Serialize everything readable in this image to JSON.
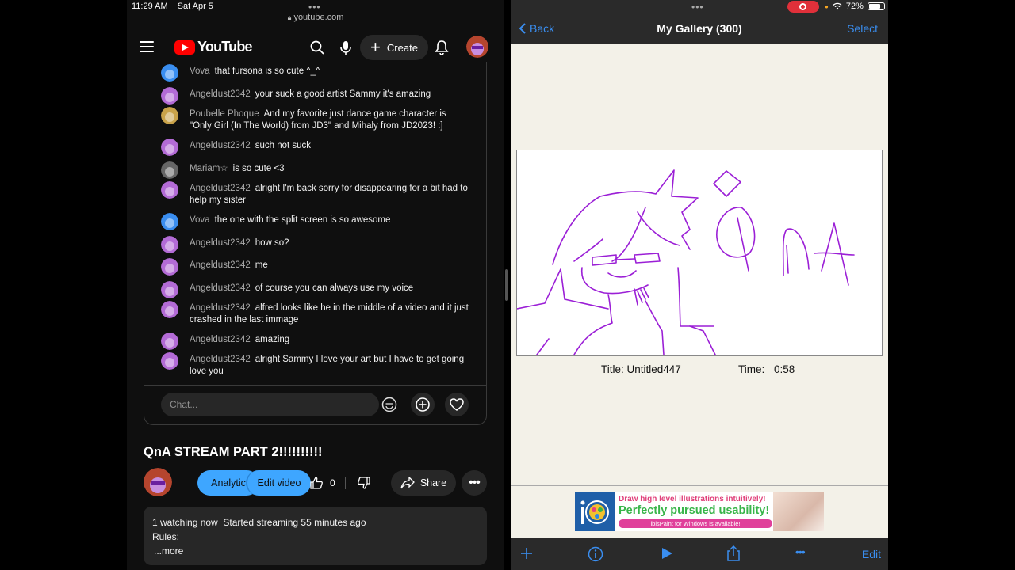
{
  "status": {
    "time": "11:29 AM",
    "date": "Sat Apr 5",
    "battery": "72%"
  },
  "browser": {
    "url": "youtube.com"
  },
  "youtube": {
    "logo_text": "YouTube",
    "create_label": "Create",
    "chat": [
      {
        "name": "Vova",
        "text": "that fursona is so cute ^_^",
        "avatar": "blue"
      },
      {
        "name": "Angeldust2342",
        "text": "your suck a good artist Sammy it's amazing",
        "avatar": "purple"
      },
      {
        "name": "Poubelle Phoque",
        "text": "And my favorite just dance game character is \"Only Girl (In The World) from JD3\" and Mihaly from JD2023! :]",
        "avatar": "gold"
      },
      {
        "name": "Angeldust2342",
        "text": "such not suck",
        "avatar": "purple"
      },
      {
        "name": "Mariam☆",
        "text": "is so cute <3",
        "avatar": "grey"
      },
      {
        "name": "Angeldust2342",
        "text": "alright I'm back sorry for disappearing for a bit had to help my sister",
        "avatar": "purple"
      },
      {
        "name": "Vova",
        "text": "the one with the split screen is so awesome",
        "avatar": "blue"
      },
      {
        "name": "Angeldust2342",
        "text": "how so?",
        "avatar": "purple"
      },
      {
        "name": "Angeldust2342",
        "text": "me",
        "avatar": "purple"
      },
      {
        "name": "Angeldust2342",
        "text": "of course you can always use my voice",
        "avatar": "purple"
      },
      {
        "name": "Angeldust2342",
        "text": "alfred looks like he in the middle of a video and it just crashed in the last immage",
        "avatar": "purple"
      },
      {
        "name": "Angeldust2342",
        "text": "amazing",
        "avatar": "purple"
      },
      {
        "name": "Angeldust2342",
        "text": "alright Sammy I love your art but I have to get going love you",
        "avatar": "purple"
      }
    ],
    "chat_placeholder": "Chat...",
    "video_title": "QnA STREAM PART 2!!!!!!!!!!",
    "analytics_label": "Analytic",
    "edit_video_label": "Edit video",
    "like_count": "0",
    "share_label": "Share",
    "description": {
      "watching": "1 watching now",
      "started": "Started streaming 55 minutes ago",
      "rules": "Rules:",
      "more": "...more"
    }
  },
  "ibis": {
    "back_label": "Back",
    "gallery_title": "My Gallery (300)",
    "select_label": "Select",
    "artwork_title": "Title: Untitled447",
    "time_label": "Time:",
    "time_value": "0:58",
    "ad": {
      "line1": "Draw high level illustrations intuitively!",
      "line2": "Perfectly pursued usability!",
      "line3": "ibisPaint for Windows is available!"
    },
    "edit_label": "Edit"
  },
  "colors": {
    "yt_red": "#ff0000",
    "yt_blue": "#3ea6ff",
    "ios_blue": "#3a8ef0",
    "drawing_stroke": "#9b1fd6"
  }
}
